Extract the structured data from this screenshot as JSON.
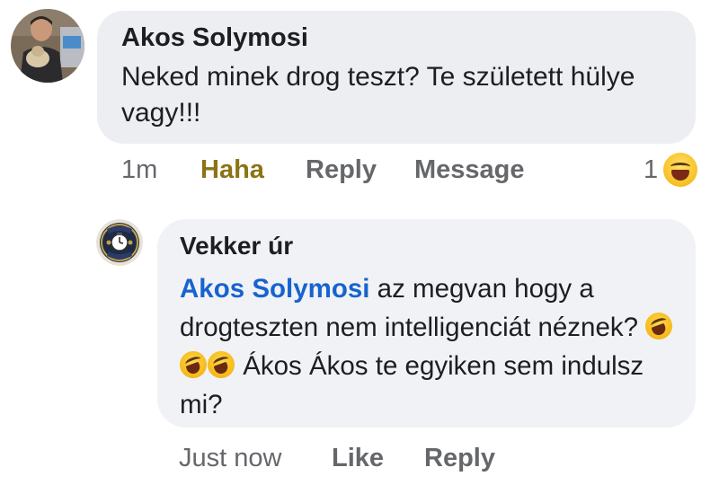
{
  "comments": [
    {
      "author": "Akos Solymosi",
      "text": "Neked minek drog teszt? Te született hülye vagy!!!",
      "time": "1m",
      "reaction_label": "Haha",
      "reply_label": "Reply",
      "message_label": "Message",
      "reaction_count": "1",
      "reaction_icon": "haha-emoji-icon"
    },
    {
      "author": "Vekker úr",
      "mention": "Akos Solymosi",
      "text_part1": " az megvan hogy a drogteszten nem intelligenciát néznek? ",
      "text_part2": " Ákos Ákos te egyiken sem indulsz mi?",
      "emojis": [
        "rolling-laughing-emoji-icon",
        "rolling-laughing-emoji-icon",
        "rolling-laughing-emoji-icon"
      ],
      "time": "Just now",
      "like_label": "Like",
      "reply_label": "Reply",
      "avatar_badge_top": "PATRIOTS",
      "avatar_badge_bottom": "EUROPE"
    }
  ],
  "colors": {
    "bubble": "#f0f2f5",
    "mention": "#1763cf",
    "haha": "#8a7416",
    "muted": "#65676b"
  }
}
